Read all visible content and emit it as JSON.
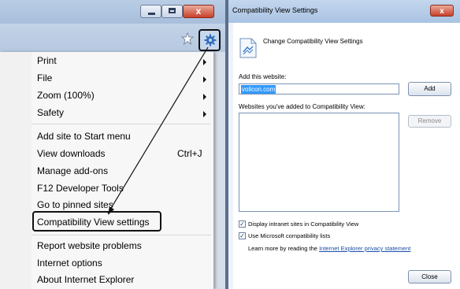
{
  "ie": {
    "window_buttons": {
      "minimize": "",
      "maximize": "",
      "close": "x"
    },
    "toolbar_icons": [
      "star-icon",
      "gear-icon"
    ],
    "menu": {
      "items": [
        {
          "label": "Print",
          "has_submenu": true
        },
        {
          "label": "File",
          "has_submenu": true
        },
        {
          "label": "Zoom (100%)",
          "has_submenu": true
        },
        {
          "label": "Safety",
          "has_submenu": true
        },
        {
          "label": "Add site to Start menu"
        },
        {
          "label": "View downloads",
          "shortcut": "Ctrl+J"
        },
        {
          "label": "Manage add-ons"
        },
        {
          "label": "F12 Developer Tools"
        },
        {
          "label": "Go to pinned sites"
        },
        {
          "label": "Compatibility View settings",
          "highlighted": true
        },
        {
          "label": "Report website problems"
        },
        {
          "label": "Internet options"
        },
        {
          "label": "About Internet Explorer"
        }
      ]
    }
  },
  "dialog": {
    "title": "Compatibility View Settings",
    "close_glyph": "x",
    "heading": "Change Compatibility View Settings",
    "add_label": "Add this website:",
    "website_value": "volicon.com",
    "add_button": "Add",
    "list_label": "Websites you've added to Compatibility View:",
    "remove_button": "Remove",
    "intranet_checkbox": {
      "label": "Display intranet sites in Compatibility View",
      "checked": true
    },
    "ms_lists_checkbox": {
      "label": "Use Microsoft compatibility lists",
      "checked": true
    },
    "learn_more_prefix": "Learn more by reading the",
    "privacy_link": "Internet Explorer privacy statement",
    "close_button": "Close"
  },
  "colors": {
    "accent_selection": "#3399ff",
    "highlight_border": "#111111",
    "link": "#1a4ea8"
  }
}
